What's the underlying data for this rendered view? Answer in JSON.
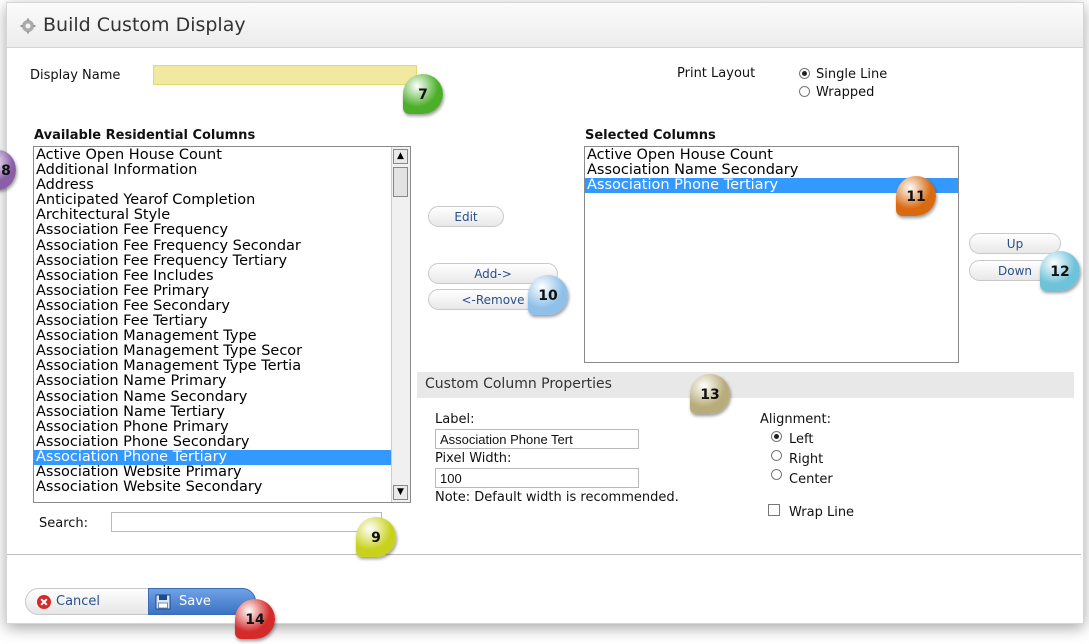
{
  "dialog": {
    "title": "Build Custom Display"
  },
  "display_name": {
    "label": "Display Name",
    "value": ""
  },
  "print_layout": {
    "label": "Print Layout",
    "options": [
      {
        "label": "Single Line",
        "selected": true
      },
      {
        "label": "Wrapped",
        "selected": false
      }
    ]
  },
  "available": {
    "heading": "Available Residential Columns",
    "items": [
      "Active Open House Count",
      "Additional Information",
      "Address",
      "Anticipated Yearof Completion",
      "Architectural Style",
      "Association Fee Frequency",
      "Association Fee Frequency Secondar",
      "Association Fee Frequency Tertiary",
      "Association Fee Includes",
      "Association Fee Primary",
      "Association Fee Secondary",
      "Association Fee Tertiary",
      "Association Management Type",
      "Association Management Type Secor",
      "Association Management Type Tertia",
      "Association Name Primary",
      "Association Name Secondary",
      "Association Name Tertiary",
      "Association Phone Primary",
      "Association Phone Secondary",
      "Association Phone Tertiary",
      "Association Website Primary",
      "Association Website Secondary"
    ],
    "selected_item": "Association Phone Tertiary"
  },
  "search": {
    "label": "Search:",
    "value": ""
  },
  "buttons": {
    "edit": "Edit",
    "add": "Add->",
    "remove": "<-Remove",
    "up": "Up",
    "down": "Down"
  },
  "selected": {
    "heading": "Selected Columns",
    "items": [
      "Active Open House Count",
      "Association Name Secondary",
      "Association Phone Tertiary"
    ],
    "selected_item": "Association Phone Tertiary"
  },
  "custom_props": {
    "heading": "Custom Column Properties",
    "label_caption": "Label:",
    "label_value": "Association Phone Tert",
    "width_caption": "Pixel Width:",
    "width_value": "100",
    "note": "Note: Default width is recommended.",
    "alignment_caption": "Alignment:",
    "alignment_options": [
      {
        "label": "Left",
        "selected": true
      },
      {
        "label": "Right",
        "selected": false
      },
      {
        "label": "Center",
        "selected": false
      }
    ],
    "wrap_label": "Wrap Line",
    "wrap_checked": false
  },
  "footer": {
    "cancel": "Cancel",
    "save": "Save"
  },
  "callouts": [
    "7",
    "8",
    "9",
    "10",
    "11",
    "12",
    "13",
    "14"
  ],
  "callout_colors": {
    "7": "#4caf2a",
    "8": "#8a5fa8",
    "9": "#c8d21e",
    "10": "#8fc0ea",
    "11": "#d96a10",
    "12": "#6fc3d9",
    "13": "#b8ad7a",
    "14": "#d42a2a"
  }
}
